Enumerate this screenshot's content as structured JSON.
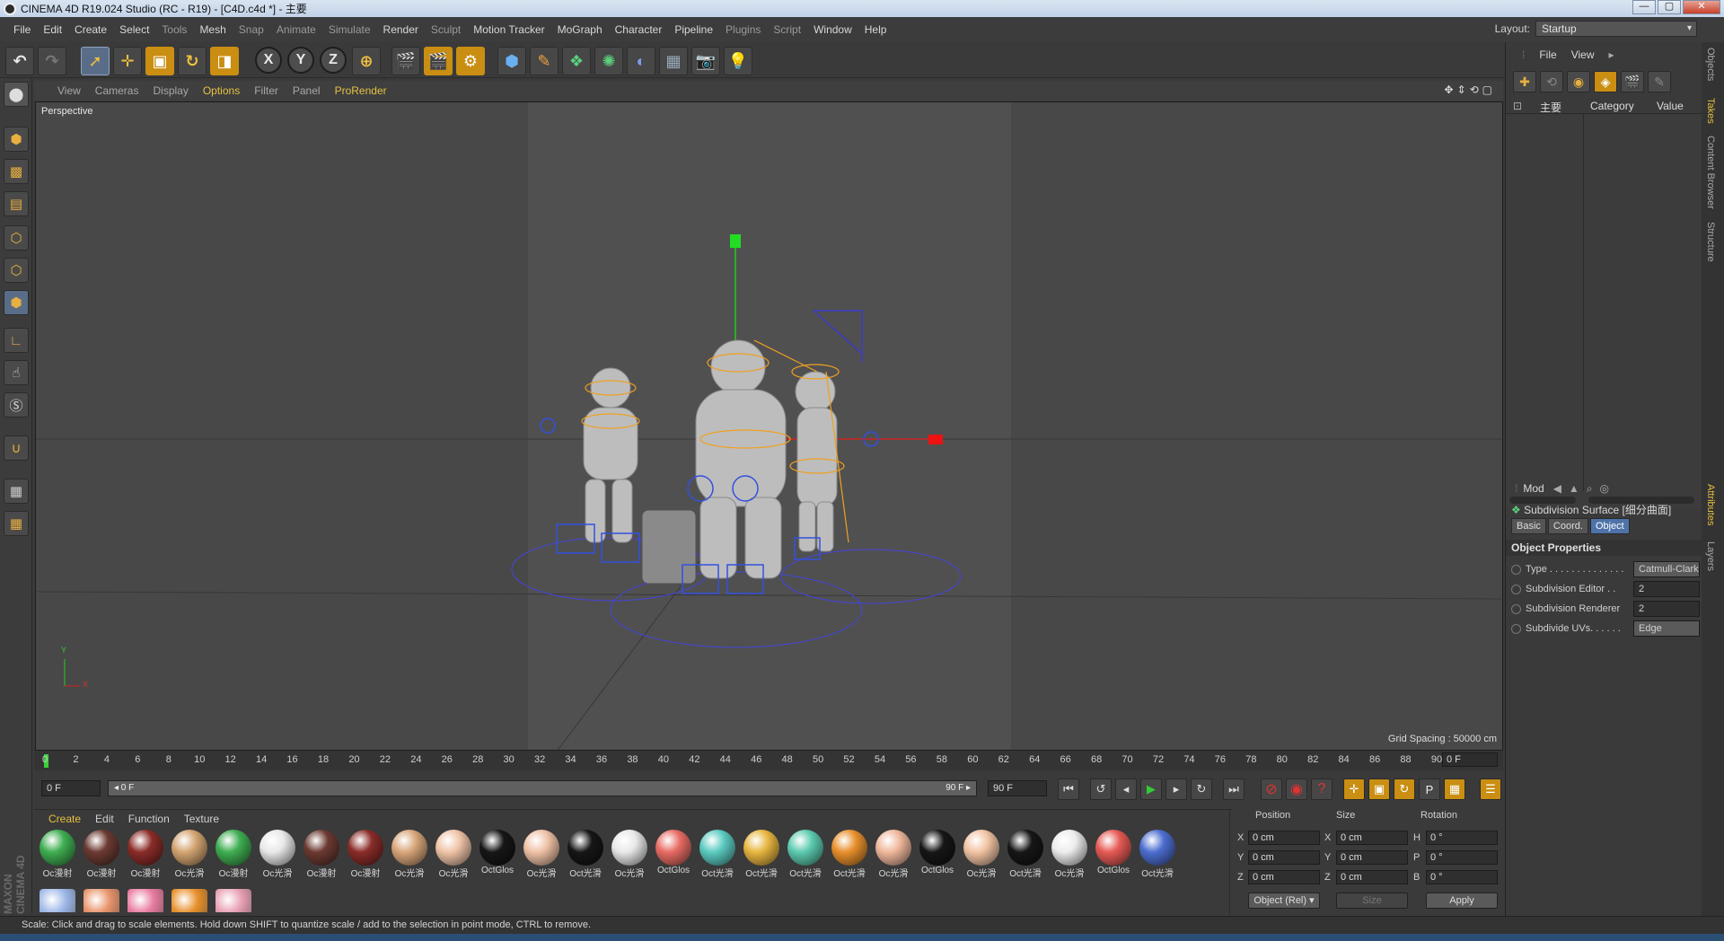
{
  "window": {
    "title": "CINEMA 4D R19.024 Studio (RC - R19) - [C4D.c4d *] - 主要",
    "controls": [
      "—",
      "▢",
      "✕"
    ]
  },
  "menubar": {
    "items": [
      "File",
      "Edit",
      "Create",
      "Select",
      "Tools",
      "Mesh",
      "Snap",
      "Animate",
      "Simulate",
      "Render",
      "Sculpt",
      "Motion Tracker",
      "MoGraph",
      "Character",
      "Pipeline",
      "Plugins",
      "Script",
      "Window",
      "Help"
    ],
    "layout_label": "Layout:",
    "layout_value": "Startup"
  },
  "toolbar": {
    "axis_x": "X",
    "axis_y": "Y",
    "axis_z": "Z"
  },
  "viewport": {
    "menu": [
      "View",
      "Cameras",
      "Display",
      "Options",
      "Filter",
      "Panel",
      "ProRender"
    ],
    "label": "Perspective",
    "grid_spacing": "Grid Spacing : 50000 cm",
    "axis_y": "Y",
    "axis_x": "X"
  },
  "timeline": {
    "ticks": [
      "0",
      "2",
      "4",
      "6",
      "8",
      "10",
      "12",
      "14",
      "16",
      "18",
      "20",
      "22",
      "24",
      "26",
      "28",
      "30",
      "32",
      "34",
      "36",
      "38",
      "40",
      "42",
      "44",
      "46",
      "48",
      "50",
      "52",
      "54",
      "56",
      "58",
      "60",
      "62",
      "64",
      "66",
      "68",
      "70",
      "72",
      "74",
      "76",
      "78",
      "80",
      "82",
      "84",
      "86",
      "88",
      "90"
    ],
    "current_frame": "0 F"
  },
  "transport": {
    "start_field": "0 F",
    "slider_left": "◂ 0 F",
    "slider_right": "90 F ▸",
    "end_field": "90 F"
  },
  "materials": {
    "menu": [
      "Create",
      "Edit",
      "Function",
      "Texture"
    ],
    "items": [
      {
        "name": "Oc漫射",
        "color": "#3fae52"
      },
      {
        "name": "Oc漫射",
        "color": "#6b3a32"
      },
      {
        "name": "Oc漫射",
        "color": "#8a2c28"
      },
      {
        "name": "Oc光滑",
        "color": "#d4a572"
      },
      {
        "name": "Oc漫射",
        "color": "#3fae52"
      },
      {
        "name": "Oc光滑",
        "color": "#e8e8e8"
      },
      {
        "name": "Oc漫射",
        "color": "#6b3a32"
      },
      {
        "name": "Oc漫射",
        "color": "#8a2c28"
      },
      {
        "name": "Oc光滑",
        "color": "#d9a67a"
      },
      {
        "name": "Oc光滑",
        "color": "#f0c4a8"
      },
      {
        "name": "OctGlos",
        "color": "#161616"
      },
      {
        "name": "Oc光滑",
        "color": "#efc2a6"
      },
      {
        "name": "Oct光滑",
        "color": "#161616"
      },
      {
        "name": "Oc光滑",
        "color": "#e8e8e8"
      },
      {
        "name": "OctGlos",
        "color": "#e86c64"
      },
      {
        "name": "Oct光滑",
        "color": "#5ccbc2"
      },
      {
        "name": "Oct光滑",
        "color": "#e8b640"
      },
      {
        "name": "Oct光滑",
        "color": "#5ccbb0"
      },
      {
        "name": "Oct光滑",
        "color": "#e8902c"
      },
      {
        "name": "Oc光滑",
        "color": "#f0b89c"
      },
      {
        "name": "OctGlos",
        "color": "#161616"
      },
      {
        "name": "Oc光滑",
        "color": "#f2c4a4"
      },
      {
        "name": "Oct光滑",
        "color": "#161616"
      },
      {
        "name": "Oc光滑",
        "color": "#ececec"
      },
      {
        "name": "OctGlos",
        "color": "#e65a54"
      },
      {
        "name": "Oct光滑",
        "color": "#4c6ed0"
      }
    ],
    "row2": [
      {
        "color": "#9fb8e8"
      },
      {
        "color": "#e8946c"
      },
      {
        "color": "#e87ca0"
      },
      {
        "color": "#e8902c"
      },
      {
        "color": "#e8a0b4"
      }
    ]
  },
  "coords": {
    "headers": [
      "Position",
      "Size",
      "Rotation"
    ],
    "rows": [
      {
        "axis": "X",
        "pos": "0 cm",
        "size_axis": "X",
        "size": "0 cm",
        "rot_axis": "H",
        "rot": "0 °"
      },
      {
        "axis": "Y",
        "pos": "0 cm",
        "size_axis": "Y",
        "size": "0 cm",
        "rot_axis": "P",
        "rot": "0 °"
      },
      {
        "axis": "Z",
        "pos": "0 cm",
        "size_axis": "Z",
        "size": "0 cm",
        "rot_axis": "B",
        "rot": "0 °"
      }
    ],
    "mode": "Object (Rel) ▾",
    "size_mode": "Size",
    "apply": "Apply"
  },
  "objects_panel": {
    "menu": [
      "File",
      "View"
    ],
    "col_name": "主要",
    "col_category": "Category",
    "col_value": "Value"
  },
  "attributes": {
    "menu": "Mod",
    "title": "Subdivision Surface [细分曲面]",
    "tabs": [
      "Basic",
      "Coord.",
      "Object"
    ],
    "section": "Object Properties",
    "props": [
      {
        "label": "Type . . . . . . . . . . . . . .",
        "value": "Catmull-Clark"
      },
      {
        "label": "Subdivision Editor . .",
        "value": "2"
      },
      {
        "label": "Subdivision Renderer",
        "value": "2"
      },
      {
        "label": "Subdivide UVs. . . . . .",
        "value": "Edge"
      }
    ]
  },
  "side_tabs": [
    "Objects",
    "Takes",
    "Content Browser",
    "Structure",
    "Attributes",
    "Layers"
  ],
  "status": "Scale: Click and drag to scale elements. Hold down SHIFT to quantize scale / add to the selection in point mode, CTRL to remove.",
  "brand": {
    "line1": "MAXON",
    "line2": "CINEMA 4D"
  }
}
